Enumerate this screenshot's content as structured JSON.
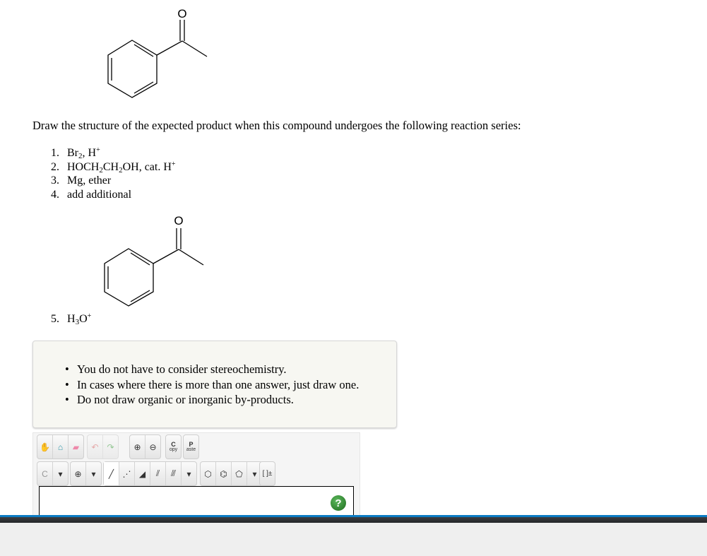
{
  "question": "Draw the structure of the expected product when this compound undergoes the following reaction series:",
  "steps": [
    {
      "num": "1.",
      "parts": [
        "Br",
        "2",
        ", H",
        "+"
      ]
    },
    {
      "num": "2.",
      "parts": [
        "HOCH",
        "2",
        "CH",
        "2",
        "OH, cat. H",
        "+"
      ]
    },
    {
      "num": "3.",
      "text": "Mg, ether"
    },
    {
      "num": "4.",
      "text": "add additional"
    },
    {
      "num": "5.",
      "parts": [
        "H",
        "3",
        "O",
        "+"
      ]
    }
  ],
  "molecule_atom": "O",
  "notes": [
    "You do not have to consider stereochemistry.",
    "In cases where there is more than one answer, just draw one.",
    "Do not draw organic or inorganic by-products."
  ],
  "toolbar": {
    "copy_c": "C",
    "copy_rest": "opy",
    "paste_p": "P",
    "paste_rest": "aste",
    "atom": "C",
    "charge": "⊕",
    "bracket": "[ ]±",
    "help": "?"
  }
}
